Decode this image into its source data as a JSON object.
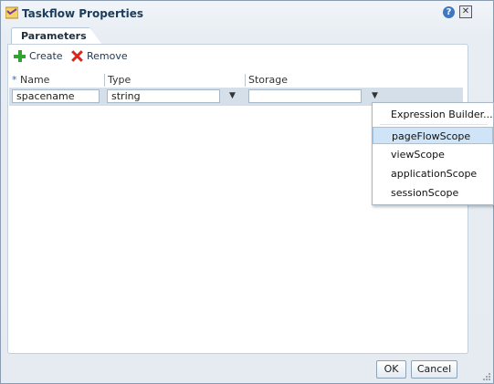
{
  "dialog": {
    "title": "Taskflow Properties",
    "help_icon": "help-icon",
    "close_icon": "close-icon"
  },
  "tab": {
    "label": "Parameters"
  },
  "toolbar": {
    "create_label": "Create",
    "remove_label": "Remove"
  },
  "grid": {
    "columns": [
      {
        "required_marker": "*",
        "label": "Name"
      },
      {
        "label": "Type"
      },
      {
        "label": "Storage"
      }
    ],
    "row": {
      "name": "spacename",
      "type": "string",
      "storage": ""
    }
  },
  "dropdown": {
    "options": [
      "Expression Builder...",
      "pageFlowScope",
      "viewScope",
      "applicationScope",
      "sessionScope"
    ],
    "highlighted": "pageFlowScope"
  },
  "footer": {
    "ok_label": "OK",
    "cancel_label": "Cancel"
  },
  "colors": {
    "title": "#1d3c5c",
    "accent": "#3e78c3",
    "selection": "#cfe4f7",
    "create_icon": "#2fa52f",
    "remove_icon": "#d8271c"
  }
}
